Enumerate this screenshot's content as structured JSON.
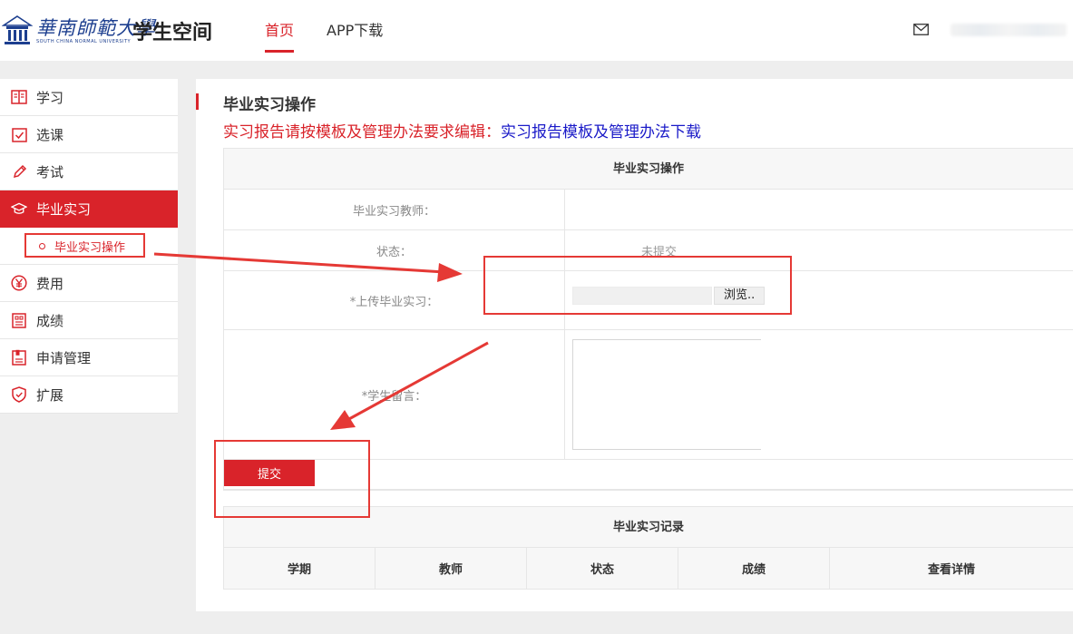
{
  "header": {
    "logo_cn": "華南師範大學",
    "logo_en": "SOUTH CHINA NORMAL UNIVERSITY",
    "app_title": "学生空间",
    "nav": [
      {
        "label": "首页",
        "active": true
      },
      {
        "label": "APP下载",
        "active": false
      }
    ]
  },
  "sidebar": {
    "items": [
      {
        "label": "学习",
        "icon": "book-icon"
      },
      {
        "label": "选课",
        "icon": "checkbox-icon"
      },
      {
        "label": "考试",
        "icon": "pencil-icon"
      },
      {
        "label": "毕业实习",
        "icon": "graduation-cap-icon",
        "active": true
      },
      {
        "label": "费用",
        "icon": "yen-icon"
      },
      {
        "label": "成绩",
        "icon": "report-icon"
      },
      {
        "label": "申请管理",
        "icon": "clipboard-icon"
      },
      {
        "label": "扩展",
        "icon": "shield-icon"
      }
    ],
    "sub_item": "毕业实习操作"
  },
  "main": {
    "page_title": "毕业实习操作",
    "notice_red": "实习报告请按模板及管理办法要求编辑：",
    "notice_link": "实习报告模板及管理办法下载",
    "form": {
      "header": "毕业实习操作",
      "teacher_label": "毕业实习教师：",
      "teacher_value": "",
      "status_label": "状态：",
      "status_value": "未提交",
      "upload_label": "*上传毕业实习：",
      "browse_label": "浏览..",
      "message_label": "*学生留言：",
      "submit_label": "提交"
    },
    "records": {
      "header": "毕业实习记录",
      "columns": [
        "学期",
        "教师",
        "状态",
        "成绩",
        "查看详情"
      ]
    }
  },
  "colors": {
    "accent": "#d9232a",
    "link": "#1a1ac8",
    "annotation": "#e53935"
  }
}
